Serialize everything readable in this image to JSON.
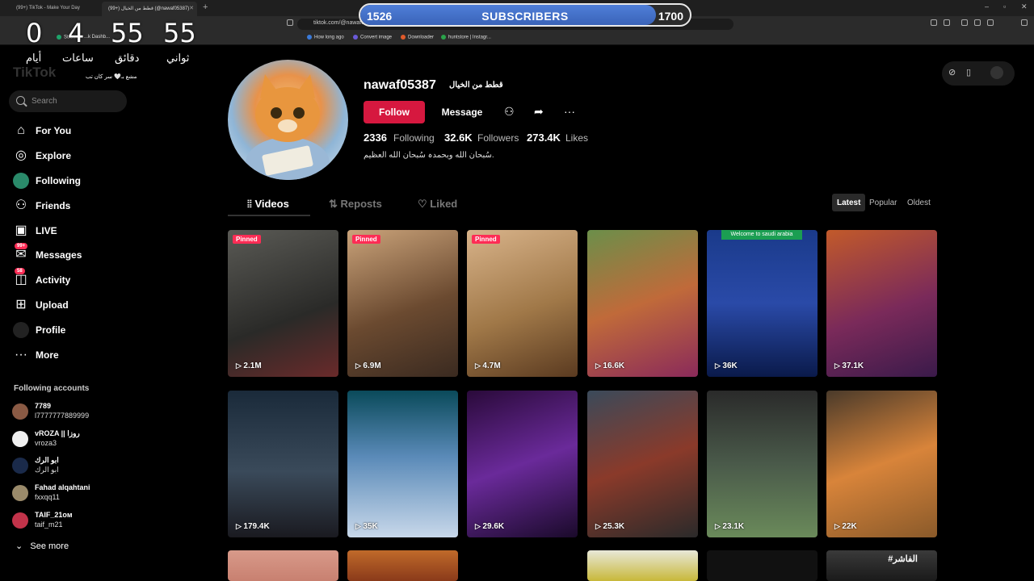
{
  "browser": {
    "tabs": [
      {
        "title": "(99+) TikTok - Make Your Day",
        "active": false
      },
      {
        "title": "(99+) قطط من الخيال (@nawaf05387)",
        "active": true
      }
    ],
    "url": "tiktok.com/@nawaf05387",
    "bookmarks": [
      "Stre...",
      "...k Dashb...",
      "How long ago",
      "Convert image",
      "Downloader",
      "huntstore | Instagr..."
    ]
  },
  "overlay": {
    "subscribers": {
      "current": "1526",
      "label": "SUBSCRIBERS",
      "goal": "1700",
      "progress": 0.898
    },
    "countdown": [
      {
        "value": "0",
        "label": "أيام"
      },
      {
        "value": "4",
        "label": "ساعات"
      },
      {
        "value": "55",
        "label": "دقائق"
      },
      {
        "value": "55",
        "label": "ثواني"
      }
    ],
    "caption": "مشع بـ🤍 سر كان تب"
  },
  "sidebar": {
    "logo": "TikTok",
    "search_placeholder": "Search",
    "nav": [
      {
        "label": "For You",
        "icon": "home-icon"
      },
      {
        "label": "Explore",
        "icon": "compass-icon"
      },
      {
        "label": "Following",
        "icon": "following-avatar-icon"
      },
      {
        "label": "Friends",
        "icon": "friends-icon"
      },
      {
        "label": "LIVE",
        "icon": "live-icon"
      },
      {
        "label": "Messages",
        "icon": "messages-icon",
        "badge": "99+"
      },
      {
        "label": "Activity",
        "icon": "activity-icon",
        "badge": "58"
      },
      {
        "label": "Upload",
        "icon": "upload-icon"
      },
      {
        "label": "Profile",
        "icon": "profile-avatar-icon"
      },
      {
        "label": "More",
        "icon": "more-icon"
      }
    ],
    "following_title": "Following accounts",
    "following": [
      {
        "name": "7789",
        "handle": "l7777777889999",
        "color": "#8a5a44"
      },
      {
        "name": "vROZA || روزا",
        "handle": "vroza3",
        "color": "#f0f0f0"
      },
      {
        "name": "ابو الرك",
        "handle": "ابو الرك",
        "color": "#1a2a4a"
      },
      {
        "name": "Fahad alqahtani",
        "handle": "fxxqq11",
        "color": "#9a8a6a"
      },
      {
        "name": "TAIF_21ᴏᴍ",
        "handle": "taif_m21",
        "color": "#c2334a"
      }
    ],
    "see_more": "See more"
  },
  "profile": {
    "username": "nawaf05387",
    "nickname": "قطط من الخيال",
    "follow_label": "Follow",
    "message_label": "Message",
    "following_count": "2336",
    "following_label": "Following",
    "followers_count": "32.6K",
    "followers_label": "Followers",
    "likes_count": "273.4K",
    "likes_label": "Likes",
    "bio": "سُبحان الله وبحمدہ سُبحان الله العظيم."
  },
  "tabs": {
    "videos": "Videos",
    "reposts": "Reposts",
    "liked": "Liked"
  },
  "sort": {
    "latest": "Latest",
    "popular": "Popular",
    "oldest": "Oldest"
  },
  "videos": [
    {
      "views": "2.1M",
      "pinned": "Pinned",
      "bg": "linear-gradient(160deg,#5a5a55,#2a2a28 60%,#6a2a2a)"
    },
    {
      "views": "6.9M",
      "pinned": "Pinned",
      "bg": "linear-gradient(160deg,#caa37a,#6b4a30 55%,#3a2a20)"
    },
    {
      "views": "4.7M",
      "pinned": "Pinned",
      "bg": "linear-gradient(160deg,#d8b38a,#a07848 55%,#5a3a20)"
    },
    {
      "views": "16.6K",
      "pinned": "",
      "bg": "linear-gradient(160deg,#6b8f4a,#c06a3a 50%,#8a2a5a)"
    },
    {
      "views": "36K",
      "pinned": "",
      "bg": "linear-gradient(180deg,#1a3a8a,#2a4aa8 50%,#0a1a4a)",
      "banner": "Welcome to saudi arabia"
    },
    {
      "views": "37.1K",
      "pinned": "",
      "bg": "linear-gradient(160deg,#c25a2a,#7a2a5a 55%,#3a1a4a)"
    },
    {
      "views": "179.4K",
      "pinned": "",
      "bg": "linear-gradient(180deg,#1a2a3a,#3a4a5a 55%,#1a1a20)"
    },
    {
      "views": "35K",
      "pinned": "",
      "bg": "linear-gradient(180deg,#0a4a5a,#5a8ab8 45%,#c8d8ea)"
    },
    {
      "views": "29.6K",
      "pinned": "",
      "bg": "linear-gradient(160deg,#2a0a3a,#6a2a9a 50%,#1a0a2a)"
    },
    {
      "views": "25.3K",
      "pinned": "",
      "bg": "linear-gradient(160deg,#3a4a5a,#8a3a2a 50%,#2a2a2a)"
    },
    {
      "views": "23.1K",
      "pinned": "",
      "bg": "linear-gradient(180deg,#2a2a2a,#4a5a4a 50%,#6a8a5a)"
    },
    {
      "views": "22K",
      "pinned": "",
      "bg": "linear-gradient(160deg,#4a3a2a,#d8843a 50%,#8a5a2a)"
    },
    {
      "views": "",
      "pinned": "",
      "bg": "linear-gradient(180deg,#d89a8a,#c88070)"
    },
    {
      "views": "",
      "pinned": "",
      "bg": "linear-gradient(180deg,#c06a2a,#8a3a1a)"
    },
    {
      "views": "",
      "pinned": "",
      "bg": "#000"
    },
    {
      "views": "",
      "pinned": "",
      "bg": "linear-gradient(180deg,#e8e8d8,#c8b83a)"
    },
    {
      "views": "",
      "pinned": "",
      "bg": "#111"
    },
    {
      "views": "",
      "pinned": "",
      "bg": "linear-gradient(180deg,#3a3a3a,#1a1a1a)",
      "banner_text": "#الفاشر"
    }
  ]
}
